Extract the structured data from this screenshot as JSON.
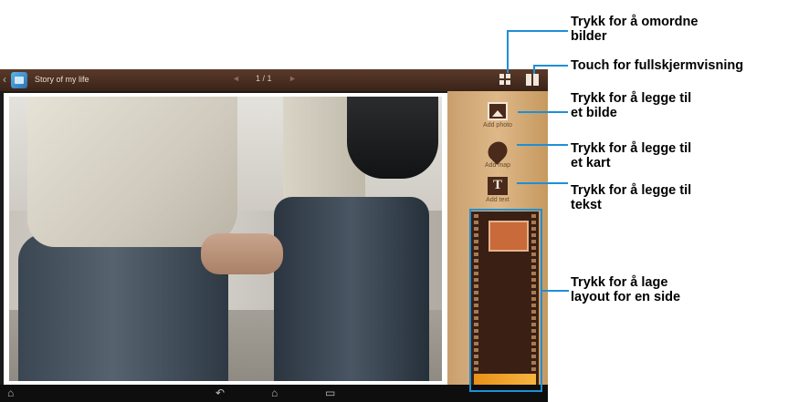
{
  "app_bar": {
    "back_icon": "chevron-left-icon",
    "title": "Story of my life",
    "pager": {
      "prev": "◄",
      "page": "1 / 1",
      "next": "►"
    }
  },
  "tools": [
    {
      "label": "Add photo",
      "icon": "add-photo-icon"
    },
    {
      "label": "Add map",
      "icon": "map-pin-icon"
    },
    {
      "label": "Add text",
      "icon": "text-icon"
    }
  ],
  "callouts": {
    "reorder": "Trykk for å omordne\nbilder",
    "fullscreen": "Touch for fullskjermvisning",
    "add_photo": "Trykk for å legge til\net bilde",
    "add_map": "Trykk for å legge til\net kart",
    "add_text": "Trykk for å legge til\ntekst",
    "layout": "Trykk for å lage\nlayout for en side"
  },
  "nav_icons": [
    "home-arrow-icon",
    "back-icon",
    "home-icon",
    "recent-apps-icon"
  ],
  "colors": {
    "accent_line": "#1f8fd6",
    "top_bar": "#4a2d20",
    "panel_wood": "#deb888"
  }
}
